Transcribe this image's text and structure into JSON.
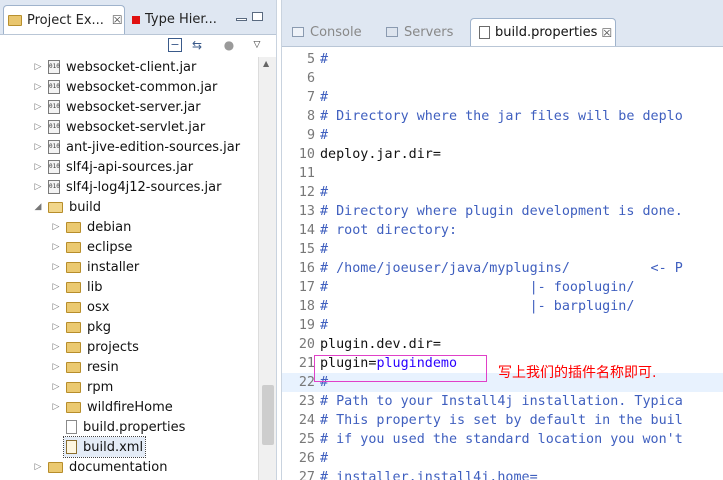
{
  "left_pane": {
    "tabs": [
      {
        "label": "Project Ex...",
        "close": "☒"
      },
      {
        "label": "Type Hier..."
      }
    ],
    "tree": [
      {
        "label": "websocket-client.jar",
        "type": "jar"
      },
      {
        "label": "websocket-common.jar",
        "type": "jar"
      },
      {
        "label": "websocket-server.jar",
        "type": "jar"
      },
      {
        "label": "websocket-servlet.jar",
        "type": "jar"
      },
      {
        "label": "ant-jive-edition-sources.jar",
        "type": "jar"
      },
      {
        "label": "slf4j-api-sources.jar",
        "type": "jar"
      },
      {
        "label": "slf4j-log4j12-sources.jar",
        "type": "jar"
      },
      {
        "label": "build",
        "type": "folder-open"
      },
      {
        "label": "debian",
        "type": "folder"
      },
      {
        "label": "eclipse",
        "type": "folder"
      },
      {
        "label": "installer",
        "type": "folder"
      },
      {
        "label": "lib",
        "type": "folder"
      },
      {
        "label": "osx",
        "type": "folder"
      },
      {
        "label": "pkg",
        "type": "folder"
      },
      {
        "label": "projects",
        "type": "folder"
      },
      {
        "label": "resin",
        "type": "folder"
      },
      {
        "label": "rpm",
        "type": "folder"
      },
      {
        "label": "wildfireHome",
        "type": "folder"
      },
      {
        "label": "build.properties",
        "type": "file"
      },
      {
        "label": "build.xml",
        "type": "xml"
      },
      {
        "label": "documentation",
        "type": "folder"
      }
    ],
    "jar_icon_text": "010"
  },
  "right_pane": {
    "tabs": [
      {
        "label": "Console",
        "icon": "console-icon"
      },
      {
        "label": "Servers",
        "icon": "servers-icon"
      },
      {
        "label": "build.properties",
        "icon": "properties-file-icon",
        "close": "☒"
      }
    ],
    "lines": [
      {
        "num": "5",
        "text": "#",
        "kind": "comment"
      },
      {
        "num": "6",
        "text": "",
        "kind": "normal"
      },
      {
        "num": "7",
        "text": "#",
        "kind": "comment"
      },
      {
        "num": "8",
        "text": "# Directory where the jar files will be deplo",
        "kind": "comment"
      },
      {
        "num": "9",
        "text": "#",
        "kind": "comment"
      },
      {
        "num": "10",
        "text": "deploy.jar.dir=",
        "kind": "normal"
      },
      {
        "num": "11",
        "text": "",
        "kind": "normal"
      },
      {
        "num": "12",
        "text": "#",
        "kind": "comment"
      },
      {
        "num": "13",
        "text": "# Directory where plugin development is done.",
        "kind": "comment"
      },
      {
        "num": "14",
        "text": "# root directory:",
        "kind": "comment"
      },
      {
        "num": "15",
        "text": "#",
        "kind": "comment"
      },
      {
        "num": "16",
        "text": "# /home/joeuser/java/myplugins/          <- P",
        "kind": "comment"
      },
      {
        "num": "17",
        "text": "#                         |- fooplugin/",
        "kind": "comment"
      },
      {
        "num": "18",
        "text": "#                         |- barplugin/",
        "kind": "comment"
      },
      {
        "num": "19",
        "text": "#",
        "kind": "comment"
      },
      {
        "num": "20",
        "text": "plugin.dev.dir=",
        "kind": "normal"
      },
      {
        "num": "21",
        "key": "plugin=",
        "value": "plugindemo",
        "kind": "keyval"
      },
      {
        "num": "22",
        "text": "#",
        "kind": "comment"
      },
      {
        "num": "23",
        "text": "# Path to your Install4j installation. Typica",
        "kind": "comment"
      },
      {
        "num": "24",
        "text": "# This property is set by default in the buil",
        "kind": "comment"
      },
      {
        "num": "25",
        "text": "# if you used the standard location you won't",
        "kind": "comment"
      },
      {
        "num": "26",
        "text": "#",
        "kind": "comment"
      },
      {
        "num": "27",
        "text": "# installer.install4j.home=",
        "kind": "comment"
      }
    ],
    "annotation": "写上我们的插件名称即可."
  },
  "colors": {
    "comment": "#3f5fbf",
    "value": "#2a00ff",
    "annotation": "#ff0000",
    "annotation_box": "#e040c8"
  }
}
